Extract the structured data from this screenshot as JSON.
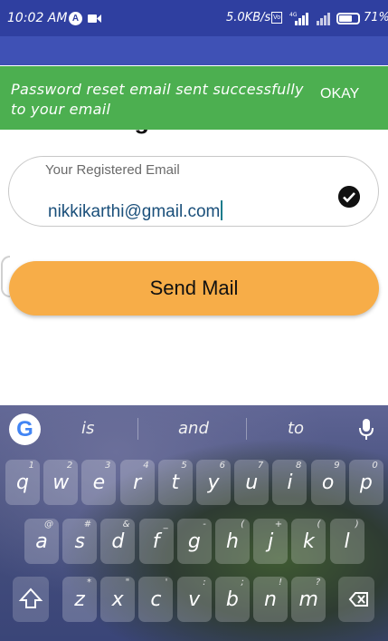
{
  "status_bar": {
    "time": "10:02 AM",
    "app_icon": "A",
    "net_speed": "5.0KB/s",
    "volte": "VoLTE",
    "battery": "71%",
    "battery_level": 0.71,
    "icons": [
      "video-icon",
      "signal-icon",
      "battery-icon"
    ]
  },
  "page": {
    "title": "Forget Password"
  },
  "snackbar": {
    "message": "Password reset email sent successfully to your email",
    "action": "OKAY",
    "color": "#4caf50"
  },
  "form": {
    "email_label": "Your Registered Email",
    "email_value": "nikkikarthi@gmail.com",
    "send_button": "Send Mail",
    "button_color": "#f7ad48"
  },
  "keyboard": {
    "suggestions": [
      "is",
      "and",
      "to"
    ],
    "row1": [
      {
        "key": "q",
        "hint": "1"
      },
      {
        "key": "w",
        "hint": "2"
      },
      {
        "key": "e",
        "hint": "3"
      },
      {
        "key": "r",
        "hint": "4"
      },
      {
        "key": "t",
        "hint": "5"
      },
      {
        "key": "y",
        "hint": "6"
      },
      {
        "key": "u",
        "hint": "7"
      },
      {
        "key": "i",
        "hint": "8"
      },
      {
        "key": "o",
        "hint": "9"
      },
      {
        "key": "p",
        "hint": "0"
      }
    ],
    "row2": [
      {
        "key": "a",
        "hint": "@"
      },
      {
        "key": "s",
        "hint": "#"
      },
      {
        "key": "d",
        "hint": "&"
      },
      {
        "key": "f",
        "hint": "_"
      },
      {
        "key": "g",
        "hint": "-"
      },
      {
        "key": "h",
        "hint": "("
      },
      {
        "key": "j",
        "hint": "+"
      },
      {
        "key": "k",
        "hint": "("
      },
      {
        "key": "l",
        "hint": ")"
      }
    ],
    "row3": [
      {
        "key": "z",
        "hint": "*"
      },
      {
        "key": "x",
        "hint": "\""
      },
      {
        "key": "c",
        "hint": "'"
      },
      {
        "key": "v",
        "hint": ":"
      },
      {
        "key": "b",
        "hint": ";"
      },
      {
        "key": "n",
        "hint": "!"
      },
      {
        "key": "m",
        "hint": "?"
      }
    ]
  }
}
